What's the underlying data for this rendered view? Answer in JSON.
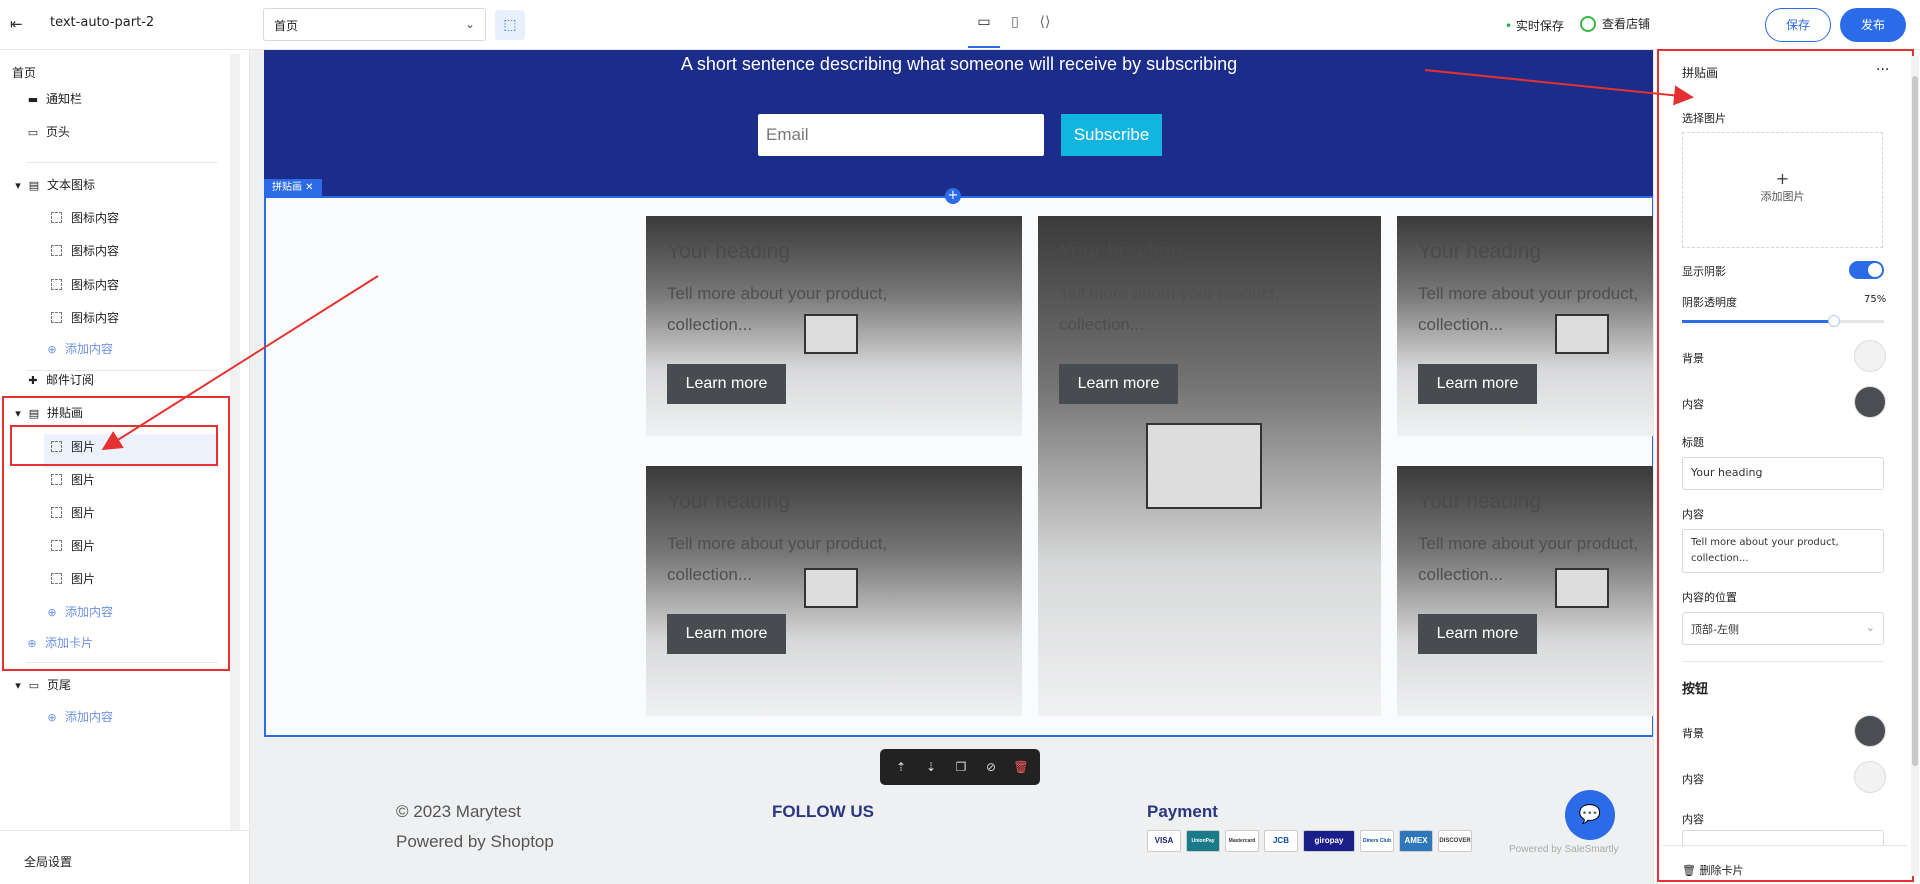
{
  "topbar": {
    "site_name": "text-auto-part-2",
    "page_select": "首页",
    "autosave": "实时保存",
    "view_store": "查看店铺",
    "save": "保存",
    "publish": "发布"
  },
  "left_panel": {
    "home": "首页",
    "items": {
      "notice_bar": "通知栏",
      "header": "页头",
      "text_icon": "文本图标",
      "icon_content": "图标内容",
      "add_content": "添加内容",
      "email_subscribe": "邮件订阅",
      "collage": "拼贴画",
      "image": "图片",
      "add_card": "添加卡片",
      "footer": "页尾"
    },
    "global_settings": "全局设置"
  },
  "canvas": {
    "subscribe_text": "A short sentence describing what someone will receive by subscribing",
    "email_placeholder": "Email",
    "subscribe_btn": "Subscribe",
    "section_tag": "拼贴画",
    "card_heading": "Your heading",
    "card_text": "Tell more about your product, collection...",
    "card_button": "Learn more",
    "footer_copyright": "© 2023 Marytest",
    "footer_powered": "Powered by Shoptop",
    "footer_follow": "FOLLOW US",
    "footer_payment": "Payment",
    "payments": [
      "VISA",
      "UnionPay",
      "Mastercard",
      "JCB",
      "giropay",
      "Diners Club",
      "AMEX",
      "DISCOVER"
    ],
    "chat_powered": "Powered by SaleSmartly"
  },
  "right_panel": {
    "title": "拼贴画",
    "more": "···",
    "select_image": "选择图片",
    "add_image": "添加图片",
    "show_shadow": "显示阴影",
    "shadow_opacity_label": "阴影透明度",
    "shadow_opacity": "75%",
    "shadow_opacity_value": 0.75,
    "background": "背景",
    "content": "内容",
    "heading_label": "标题",
    "heading_value": "Your heading",
    "content_label": "内容",
    "content_value": "Tell more about your product, collection...",
    "content_position_label": "内容的位置",
    "content_position_value": "顶部-左侧",
    "button_section": "按钮",
    "button_bg": "背景",
    "button_content": "内容",
    "button_text_label": "内容",
    "delete_card": "删除卡片",
    "colors": {
      "background": "#f2f2f2",
      "content": "#4a4d52",
      "button_bg": "#4a4d52",
      "button_content": "#f2f2f2"
    }
  },
  "colors": {
    "accent": "#2c6be8",
    "highlight": "#e53131",
    "subscribe_bg": "#1b2c8a",
    "subscribe_button": "#12b5e0"
  }
}
